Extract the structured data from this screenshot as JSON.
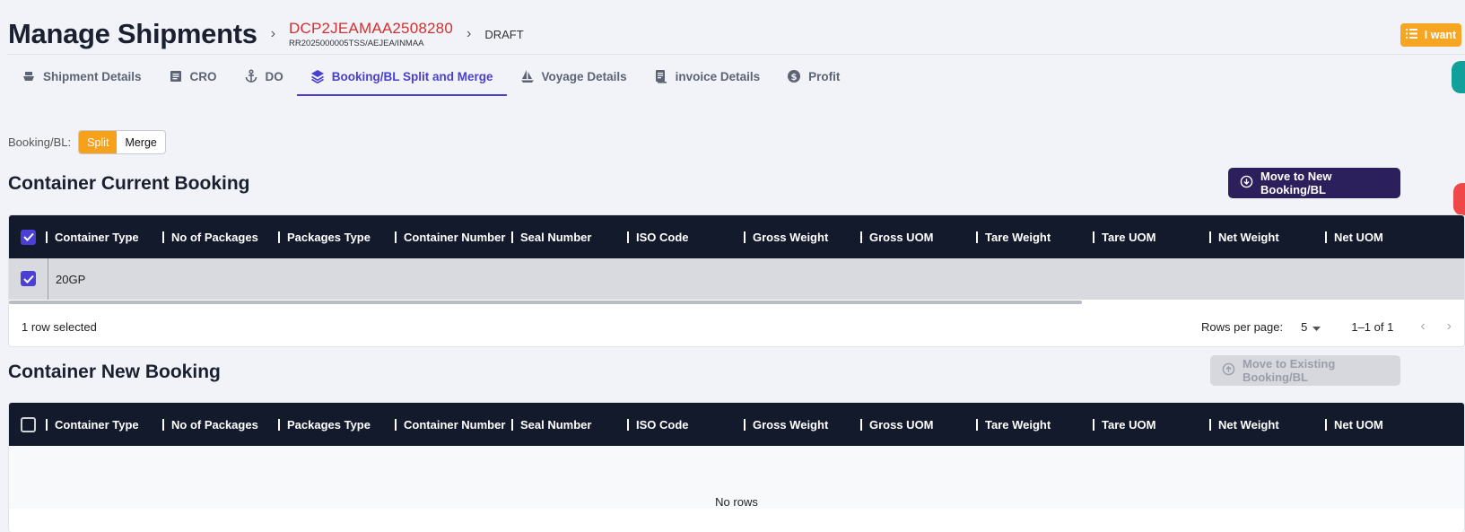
{
  "header": {
    "title": "Manage Shipments",
    "booking_id": "DCP2JEAMAA2508280",
    "booking_ref": "RR2025000005TSS/AEJEA/INMAA",
    "status": "DRAFT",
    "iwant_label": "I want"
  },
  "tabs": [
    {
      "label": "Shipment Details",
      "icon": "ship-icon"
    },
    {
      "label": "CRO",
      "icon": "document-icon"
    },
    {
      "label": "DO",
      "icon": "anchor-icon"
    },
    {
      "label": "Booking/BL Split and Merge",
      "icon": "layers-icon"
    },
    {
      "label": "Voyage Details",
      "icon": "sailboat-icon"
    },
    {
      "label": "invoice Details",
      "icon": "invoice-icon"
    },
    {
      "label": "Profit",
      "icon": "dollar-icon"
    }
  ],
  "toggle": {
    "label": "Booking/BL:",
    "options": [
      "Split",
      "Merge"
    ],
    "selected": "Split"
  },
  "columns": [
    "Container Type",
    "No of Packages",
    "Packages Type",
    "Container Number",
    "Seal Number",
    "ISO Code",
    "Gross Weight",
    "Gross UOM",
    "Tare Weight",
    "Tare UOM",
    "Net Weight",
    "Net UOM"
  ],
  "current": {
    "title": "Container Current Booking",
    "move_button": "Move to New Booking/BL",
    "rows": [
      {
        "container_type": "20GP"
      }
    ],
    "selected_text": "1 row selected",
    "rows_per_page_label": "Rows per page:",
    "rows_per_page": "5",
    "range": "1–1 of 1"
  },
  "new": {
    "title": "Container New Booking",
    "move_button": "Move to Existing Booking/BL",
    "empty_text": "No rows"
  },
  "colors": {
    "accent": "#4a3fd1",
    "orange": "#f5a11b",
    "header_dark": "#131a2c",
    "primary_button": "#2b1f5c",
    "error_red": "#d32f2f"
  }
}
